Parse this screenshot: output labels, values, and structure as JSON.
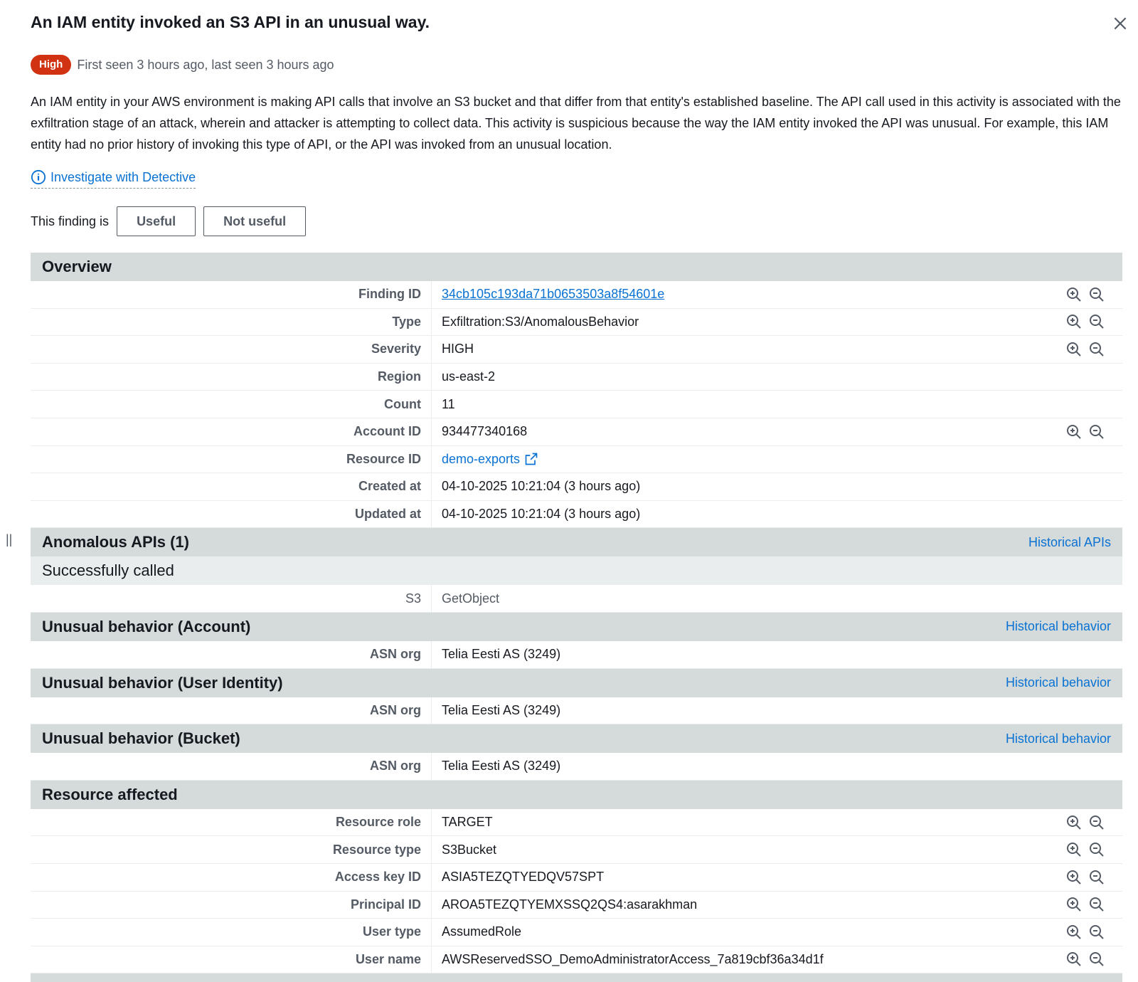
{
  "title": "An IAM entity invoked an S3 API in an unusual way.",
  "severity_badge": "High",
  "seen_text": "First seen 3 hours ago, last seen 3 hours ago",
  "description": "An IAM entity in your AWS environment is making API calls that involve an S3 bucket and that differ from that entity's established baseline. The API call used in this activity is associated with the exfiltration stage of an attack, wherein and attacker is attempting to collect data. This activity is suspicious because the way the IAM entity invoked the API was unusual. For example, this IAM entity had no prior history of invoking this type of API, or the API was invoked from an unusual location.",
  "investigate_label": "Investigate with Detective",
  "feedback": {
    "label": "This finding is",
    "useful": "Useful",
    "not_useful": "Not useful"
  },
  "overview": {
    "title": "Overview",
    "rows": [
      {
        "key": "Finding ID",
        "value": "34cb105c193da71b0653503a8f54601e"
      },
      {
        "key": "Type",
        "value": "Exfiltration:S3/AnomalousBehavior"
      },
      {
        "key": "Severity",
        "value": "HIGH"
      },
      {
        "key": "Region",
        "value": "us-east-2"
      },
      {
        "key": "Count",
        "value": "11"
      },
      {
        "key": "Account ID",
        "value": "934477340168"
      },
      {
        "key": "Resource ID",
        "value": "demo-exports"
      },
      {
        "key": "Created at",
        "value": "04-10-2025 10:21:04 (3 hours ago)"
      },
      {
        "key": "Updated at",
        "value": "04-10-2025 10:21:04 (3 hours ago)"
      }
    ]
  },
  "anomalous_apis": {
    "title": "Anomalous APIs (1)",
    "link": "Historical APIs",
    "subheader": "Successfully called",
    "row": {
      "key": "S3",
      "value": "GetObject"
    }
  },
  "unusual_account": {
    "title": "Unusual behavior (Account)",
    "link": "Historical behavior",
    "row": {
      "key": "ASN org",
      "value": "Telia Eesti AS (3249)"
    }
  },
  "unusual_user": {
    "title": "Unusual behavior (User Identity)",
    "link": "Historical behavior",
    "row": {
      "key": "ASN org",
      "value": "Telia Eesti AS (3249)"
    }
  },
  "unusual_bucket": {
    "title": "Unusual behavior (Bucket)",
    "link": "Historical behavior",
    "row": {
      "key": "ASN org",
      "value": "Telia Eesti AS (3249)"
    }
  },
  "resource_affected": {
    "title": "Resource affected",
    "rows": [
      {
        "key": "Resource role",
        "value": "TARGET"
      },
      {
        "key": "Resource type",
        "value": "S3Bucket"
      },
      {
        "key": "Access key ID",
        "value": "ASIA5TEZQTYEDQV57SPT"
      },
      {
        "key": "Principal ID",
        "value": "AROA5TEZQTYEMXSSQ2QS4:asarakhman"
      },
      {
        "key": "User type",
        "value": "AssumedRole"
      },
      {
        "key": "User name",
        "value": "AWSReservedSSO_DemoAdministratorAccess_7a819cbf36a34d1f"
      }
    ]
  },
  "colors": {
    "badge": "#d13212",
    "link": "#0972d3",
    "header_bg": "#d5dbdb"
  }
}
